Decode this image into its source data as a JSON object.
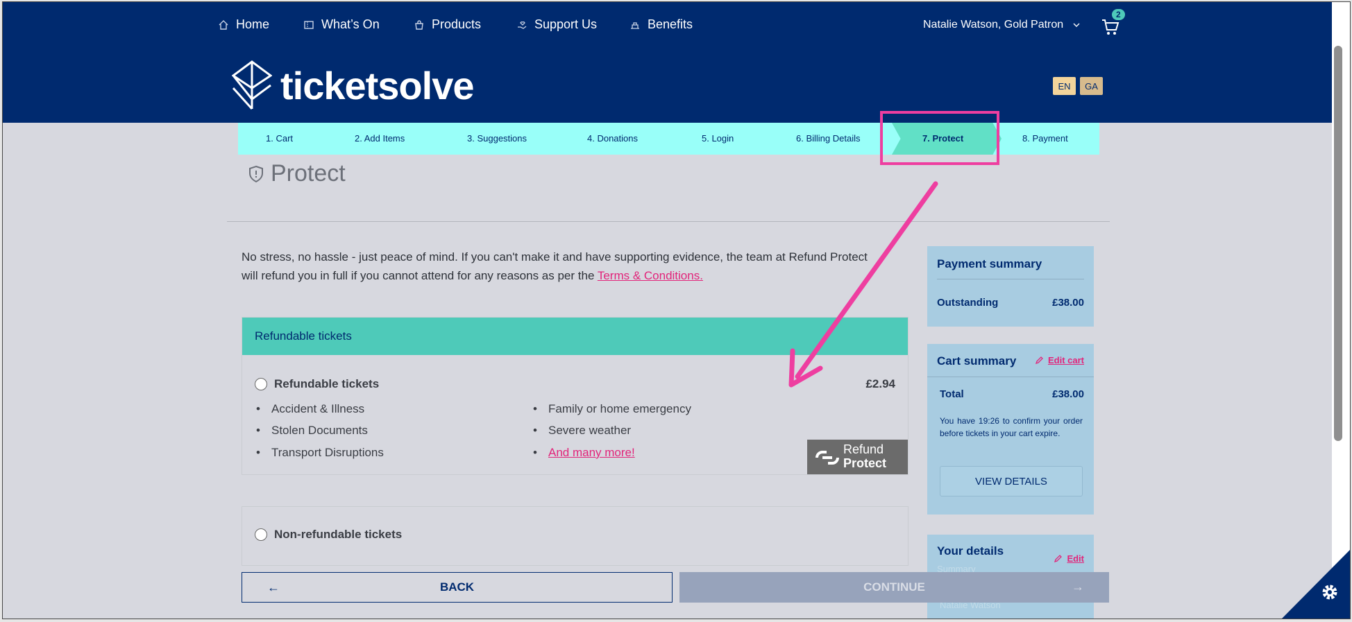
{
  "nav": {
    "items": [
      {
        "label": "Home",
        "icon": "home-icon"
      },
      {
        "label": "What’s On",
        "icon": "ticket-icon"
      },
      {
        "label": "Products",
        "icon": "bag-icon"
      },
      {
        "label": "Support Us",
        "icon": "hand-heart-icon"
      },
      {
        "label": "Benefits",
        "icon": "benefits-icon"
      }
    ],
    "user_label": "Natalie Watson, Gold Patron",
    "cart_count": "2"
  },
  "brand": {
    "logo_text": "ticketsolve",
    "color": "#002a6f"
  },
  "languages": [
    {
      "label": "EN",
      "color": "#f3d49b"
    },
    {
      "label": "GA",
      "color": "#d7bb8d"
    }
  ],
  "stepper": {
    "steps": [
      "1. Cart",
      "2. Add Items",
      "3. Suggestions",
      "4. Donations",
      "5. Login",
      "6. Billing Details",
      "7. Protect",
      "8. Payment"
    ],
    "active": "7. Protect",
    "bg": "#99fff9",
    "active_bg": "#61e0c6"
  },
  "page": {
    "title": "Protect",
    "intro_line1": "No stress, no hassle - just peace of mind. If you can't make it and have supporting evidence, the team at Refund Protect",
    "intro_line2": "will refund you in full if you cannot attend for any reasons as per the",
    "terms_link": "Terms & Conditions."
  },
  "refund": {
    "header": "Refundable tickets",
    "option_label": "Refundable tickets",
    "price": "£2.94",
    "features_left": [
      "Accident & Illness",
      "Stolen Documents",
      "Transport Disruptions"
    ],
    "features_right": [
      "Family or home emergency",
      "Severe weather"
    ],
    "more_link": "And many more!",
    "logo_line1": "Refund",
    "logo_line2": "Protect",
    "non_refundable_label": "Non-refundable tickets"
  },
  "buttons": {
    "back": "BACK",
    "continue": "CONTINUE"
  },
  "payment_summary": {
    "title": "Payment summary",
    "outstanding_label": "Outstanding",
    "outstanding_value": "£38.00"
  },
  "cart_summary": {
    "title": "Cart summary",
    "edit_label": "Edit cart",
    "total_label": "Total",
    "total_value": "£38.00",
    "timer_text": "You have 19:26 to confirm your order before tickets in your cart expire.",
    "view_details": "VIEW DETAILS"
  },
  "your_details": {
    "title": "Your details",
    "edit_label": "Edit",
    "faded_1": "Summary",
    "faded_2": "Natalie Watson"
  },
  "colors": {
    "accent_pink": "#ee3ea0",
    "teal": "#4ecab9",
    "panel": "#a8cce1"
  }
}
